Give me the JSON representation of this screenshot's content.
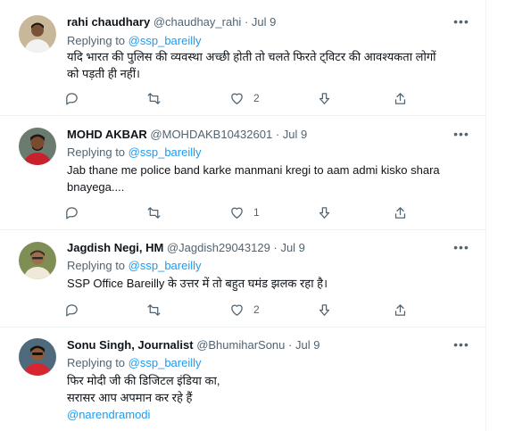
{
  "reply_prefix": "Replying to",
  "tweets": [
    {
      "name": "rahi chaudhary",
      "handle": "@chaudhay_rahi",
      "sep": "·",
      "time": "Jul 9",
      "replying_to": "@ssp_bareilly",
      "text_lines": [
        "यदि भारत की पुलिस की व्यवस्था अच्छी होती तो चलते फिरते ट्विटर की आवश्यकता लोगों",
        "को पड़ती ही नहीं।"
      ],
      "likes": "2",
      "avatar_colors": {
        "bg": "#c9b79a",
        "shirt": "#f2f2f2",
        "skin": "#7a5236",
        "hair": "#1b1410"
      }
    },
    {
      "name": "MOHD AKBAR",
      "handle": "@MOHDAKB10432601",
      "sep": "·",
      "time": "Jul 9",
      "replying_to": "@ssp_bareilly",
      "text_lines": [
        "Jab thane me police band karke manmani kregi to aam admi kisko shara",
        "bnayega...."
      ],
      "likes": "1",
      "avatar_colors": {
        "bg": "#6b7b70",
        "shirt": "#c8202c",
        "skin": "#7a4b30",
        "hair": "#1e1612"
      }
    },
    {
      "name": "Jagdish Negi, HM",
      "handle": "@Jagdish29043129",
      "sep": "·",
      "time": "Jul 9",
      "replying_to": "@ssp_bareilly",
      "text_lines": [
        "SSP Office Bareilly के उत्तर में तो बहुत घमंड झलक रहा है।"
      ],
      "likes": "2",
      "avatar_colors": {
        "bg": "#7f8e55",
        "shirt": "#efe9da",
        "skin": "#a06e4c",
        "hair": "#3a3028"
      }
    },
    {
      "name": "Sonu Singh, Journalist",
      "handle": "@BhumiharSonu",
      "sep": "·",
      "time": "Jul 9",
      "replying_to": "@ssp_bareilly",
      "text_lines": [
        "फिर मोदी जी की डिजिटल इंडिया का,",
        "सरासर आप अपमान कर रहे हैं"
      ],
      "mention_line": "@narendramodi",
      "likes": "",
      "avatar_colors": {
        "bg": "#4f6a7d",
        "shirt": "#d7262f",
        "skin": "#8a5a3a",
        "hair": "#15110e"
      }
    }
  ],
  "colors": {
    "link": "#1d9bf0",
    "muted": "#536471",
    "text": "#0f1419",
    "divider": "#eff3f4"
  }
}
